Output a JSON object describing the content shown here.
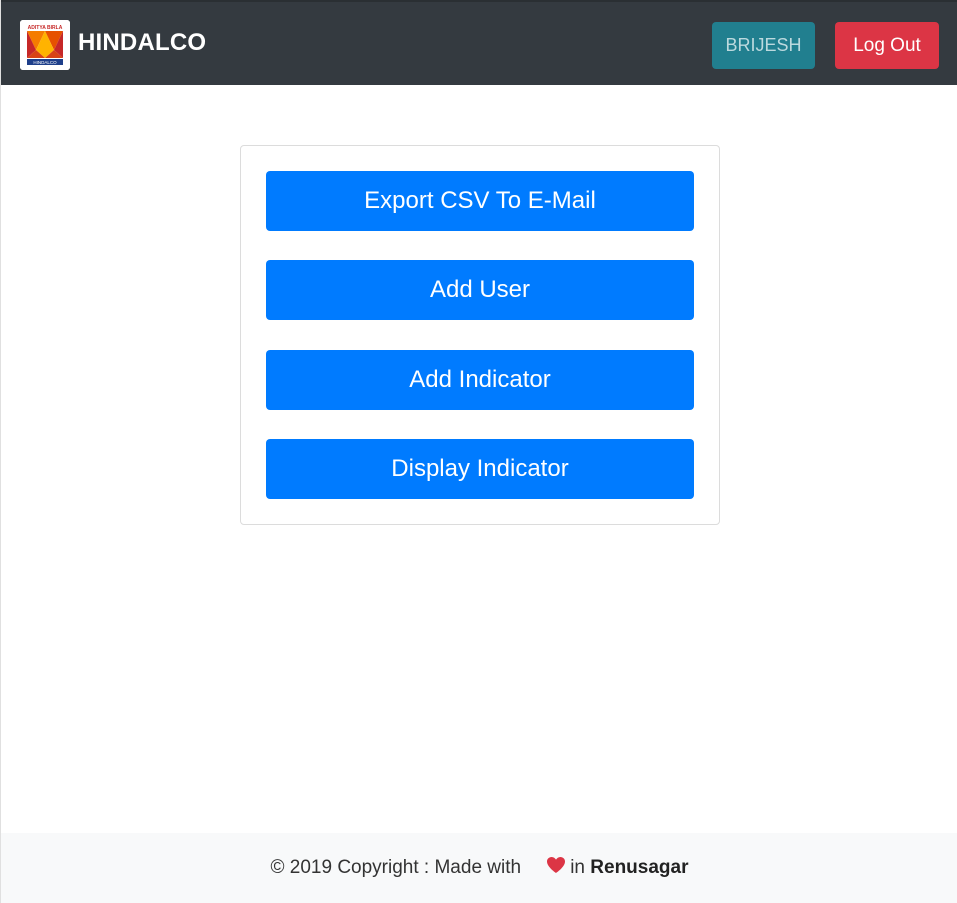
{
  "header": {
    "brand": "HINDALCO",
    "logo_text_top": "ADITYA BIRLA",
    "logo_text_bottom": "HINDALCO",
    "user_button": "BRIJESH",
    "logout_button": "Log Out",
    "colors": {
      "navbar": "#343a40",
      "user_button": "#217f8f",
      "logout_button": "#dc3545"
    }
  },
  "main": {
    "actions": [
      {
        "label": "Export CSV To E-Mail"
      },
      {
        "label": "Add User"
      },
      {
        "label": "Add Indicator"
      },
      {
        "label": "Display Indicator"
      }
    ],
    "colors": {
      "action_button": "#007bff"
    }
  },
  "footer": {
    "prefix": "© 2019 Copyright : Made with",
    "heart_icon": "heart-icon",
    "middle": "in",
    "place": "Renusagar",
    "colors": {
      "heart": "#dc3545"
    }
  }
}
